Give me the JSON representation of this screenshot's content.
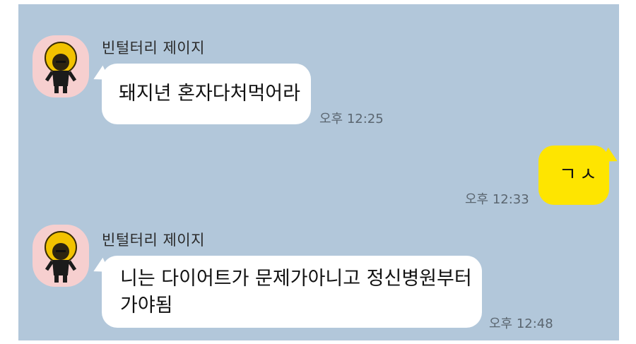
{
  "messages": [
    {
      "sender": "빈털터리 제이지",
      "text": "돼지년 혼자다처먹어라",
      "time": "오후 12:25"
    },
    {
      "text": "ㄱㅅ",
      "time": "오후 12:33"
    },
    {
      "sender": "빈털터리 제이지",
      "text_line1": "니는 다이어트가 문제가아니고 정신병원부터",
      "text_line2": "가야됨",
      "time": "오후 12:48"
    }
  ],
  "colors": {
    "background": "#b2c7da",
    "incoming_bubble": "#ffffff",
    "outgoing_bubble": "#fee500",
    "avatar_bg": "#f6cfcf"
  },
  "icons": {
    "avatar": "afro-character-avatar-icon"
  }
}
